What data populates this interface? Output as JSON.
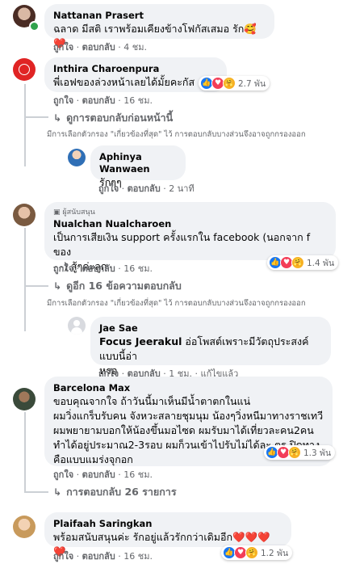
{
  "comments": {
    "c1": {
      "name": "Nattanan Prasert",
      "text": "ฉลาด มีสติ เราพร้อมเคียงข้างโฟกัสเสมอ รัก🥰❤️",
      "like": "ถูกใจ",
      "reply": "ตอบกลับ",
      "time": "4 ชม."
    },
    "c2": {
      "name": "Inthira Charoenpura",
      "text": "พี่เอฟของล่วงหน้าเลยได้มั้ยคะกัส",
      "like": "ถูกใจ",
      "reply": "ตอบกลับ",
      "time": "16 ชม.",
      "reactions": "2.7 พัน",
      "more": "ดูการตอบกลับก่อนหน้านี้",
      "note": "มีการเลือกตัวกรอง \"เกี่ยวข้องที่สุด\" ไว้ การตอบกลับบางส่วนจึงอาจถูกกรองออก"
    },
    "c3": {
      "name": "Aphinya Wanwaen",
      "text": "รักๆๆ",
      "like": "ถูกใจ",
      "reply": "ตอบกลับ",
      "time": "2 นาที"
    },
    "c4": {
      "badge": "ผู้สนับสนุน",
      "name": "Nualchan Nualcharoen",
      "text1": "เป็นการเสียเงิน support ครั้งแรกใน facebook (นอกจาก f ของ",
      "text2": "- -) สู้ๆค่ะลูก",
      "like": "ถูกใจ",
      "reply": "ตอบกลับ",
      "time": "16 ชม.",
      "reactions": "1.4 พัน",
      "more": "ดูอีก 16 ข้อความตอบกลับ",
      "note": "มีการเลือกตัวกรอง \"เกี่ยวข้องที่สุด\" ไว้ การตอบกลับบางส่วนจึงอาจถูกกรองออก"
    },
    "c5": {
      "name": "Jae Sae",
      "mention": "Focus Jeerakul",
      "text1": " อ่อโพสต์เพราะมีวัตถุประสงค์แบบนี้อ่า",
      "text2": "หรอ",
      "like": "ถูกใจ",
      "reply": "ตอบกลับ",
      "time": "1 ชม.",
      "edited": "แก้ไขแล้ว"
    },
    "c6": {
      "name": "Barcelona Max",
      "lines": [
        "ขอบคุณจากใจ ถ้าวันนี้มาเห็นมีน้ำตาตกในแน่",
        "ผมวิ่งแกร็บรับคน จังหวะสลายชุมนุม น้องๆวิ่งหนีมาทางราชเทวี",
        "ผมพยายามบอกให้น้องขึ้นมอไซด ผมรับมาได้เที่ยวละคน2คน",
        "ทำได้อยู่ประมาณ2-3รอบ ผมก็วนเข้าไปรับไม่ได้ละ ตร.ปิดทาง",
        "คือแบบแมร่งจุกอก"
      ],
      "like": "ถูกใจ",
      "reply": "ตอบกลับ",
      "time": "16 ชม.",
      "reactions": "1.3 พัน",
      "more": "การตอบกลับ 26 รายการ"
    },
    "c7": {
      "name": "Plaifaah Saringkan",
      "text": "พร้อมสนับสนุนค่ะ รักอยู่แล้วรักกว่าเดิมอีก❤️❤️❤️❤️",
      "like": "ถูกใจ",
      "reply": "ตอบกลับ",
      "time": "16 ชม.",
      "reactions": "1.2 พัน"
    }
  },
  "separator": "·",
  "colors": {
    "bubble": "#f0f2f5",
    "secondary_text": "#65676b",
    "like_blue": "#1877f2",
    "love_red": "#f33e58",
    "online_green": "#31a24c"
  }
}
